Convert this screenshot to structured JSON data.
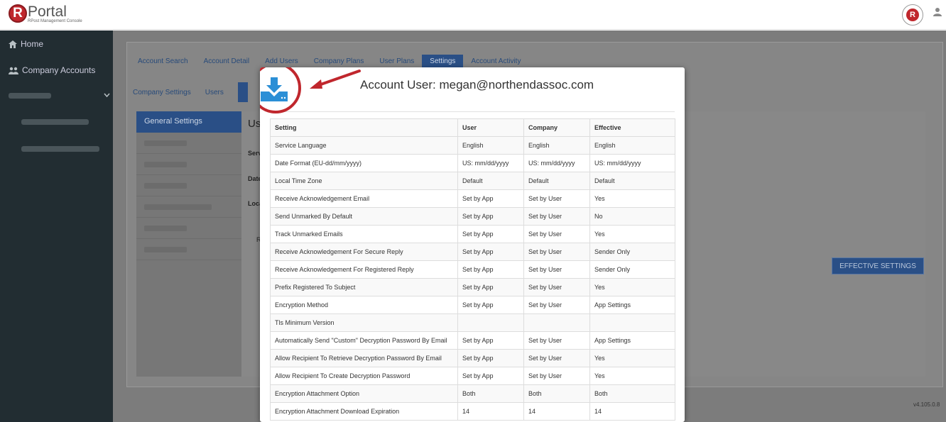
{
  "header": {
    "logo_letter": "R",
    "logo_name": "Portal",
    "logo_subtitle": "RPost Management Console",
    "badge_letter": "R"
  },
  "sidebar": {
    "items": [
      {
        "label": "Home",
        "icon": "home-icon"
      },
      {
        "label": "Company Accounts",
        "icon": "users-icon"
      }
    ]
  },
  "tabs": {
    "primary": [
      "Account Search",
      "Account Detail",
      "Add Users",
      "Company Plans",
      "User Plans",
      "Settings",
      "Account Activity"
    ],
    "primary_active": "Settings",
    "secondary": [
      "Company Settings",
      "Users"
    ]
  },
  "settings_nav": {
    "active": "General Settings"
  },
  "content": {
    "heading_fragment": "Us",
    "label_1": "Serv",
    "label_2": "Date",
    "label_3": "Loca",
    "label_4": "R",
    "effective_button": "EFFECTIVE SETTINGS",
    "version": "v4.105.0.8"
  },
  "modal": {
    "title": "Account User: megan@northendassoc.com",
    "columns": [
      "Setting",
      "User",
      "Company",
      "Effective"
    ],
    "rows": [
      [
        "Service Language",
        "English",
        "English",
        "English"
      ],
      [
        "Date Format (EU-dd/mm/yyyy)",
        "US: mm/dd/yyyy",
        "US: mm/dd/yyyy",
        "US: mm/dd/yyyy"
      ],
      [
        "Local Time Zone",
        "Default",
        "Default",
        "Default"
      ],
      [
        "Receive Acknowledgement Email",
        "Set by App",
        "Set by User",
        "Yes"
      ],
      [
        "Send Unmarked By Default",
        "Set by App",
        "Set by User",
        "No"
      ],
      [
        "Track Unmarked Emails",
        "Set by App",
        "Set by User",
        "Yes"
      ],
      [
        "Receive Acknowledgement For Secure Reply",
        "Set by App",
        "Set by User",
        "Sender Only"
      ],
      [
        "Receive Acknowledgement For Registered Reply",
        "Set by App",
        "Set by User",
        "Sender Only"
      ],
      [
        "Prefix Registered To Subject",
        "Set by App",
        "Set by User",
        "Yes"
      ],
      [
        "Encryption Method",
        "Set by App",
        "Set by User",
        "App Settings"
      ],
      [
        "Tls Minimum Version",
        "",
        "",
        ""
      ],
      [
        "Automatically Send \"Custom\" Decryption Password By Email",
        "Set by App",
        "Set by User",
        "App Settings"
      ],
      [
        "Allow Recipient To Retrieve Decryption Password By Email",
        "Set by App",
        "Set by User",
        "Yes"
      ],
      [
        "Allow Recipient To Create Decryption Password",
        "Set by App",
        "Set by User",
        "Yes"
      ],
      [
        "Encryption Attachment Option",
        "Both",
        "Both",
        "Both"
      ],
      [
        "Encryption Attachment Download Expiration",
        "14",
        "14",
        "14"
      ]
    ]
  },
  "colors": {
    "sidebar_bg": "#222d32",
    "accent": "#2a4f86",
    "brand_red": "#c0272d",
    "download_blue": "#2b8fd6"
  }
}
